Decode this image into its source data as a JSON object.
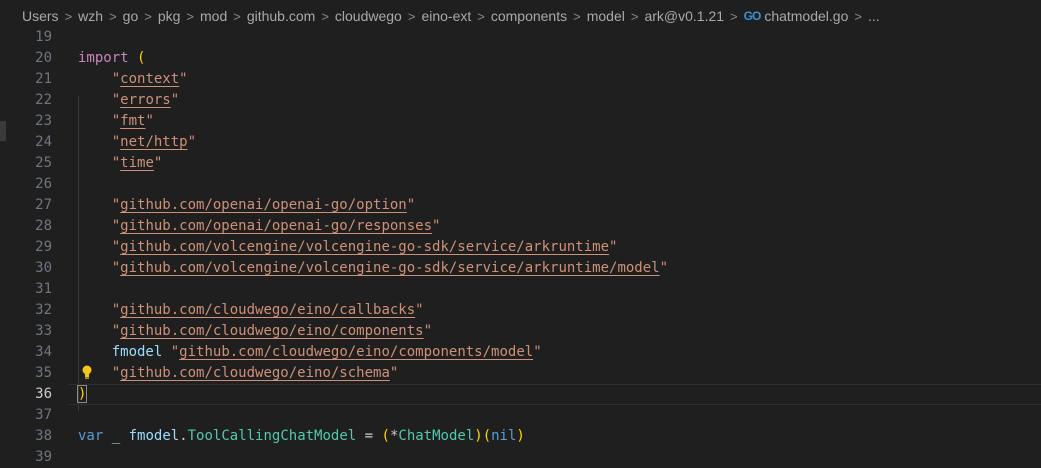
{
  "breadcrumb": {
    "items": [
      "Users",
      "wzh",
      "go",
      "pkg",
      "mod",
      "github.com",
      "cloudwego",
      "eino-ext",
      "components",
      "model",
      "ark@v0.1.21"
    ],
    "file_icon": "GO",
    "file": "chatmodel.go",
    "more": "..."
  },
  "lines": {
    "l19": "19",
    "l20": "20",
    "l21": "21",
    "l22": "22",
    "l23": "23",
    "l24": "24",
    "l25": "25",
    "l26": "26",
    "l27": "27",
    "l28": "28",
    "l29": "29",
    "l30": "30",
    "l31": "31",
    "l32": "32",
    "l33": "33",
    "l34": "34",
    "l35": "35",
    "l36": "36",
    "l37": "37",
    "l38": "38",
    "l39": "39"
  },
  "code": {
    "import_kw": "import",
    "open_paren": "(",
    "close_paren": ")",
    "imp_context": "context",
    "imp_errors": "errors",
    "imp_fmt": "fmt",
    "imp_nethttp": "net/http",
    "imp_time": "time",
    "imp_option": "github.com/openai/openai-go/option",
    "imp_responses": "github.com/openai/openai-go/responses",
    "imp_arkruntime": "github.com/volcengine/volcengine-go-sdk/service/arkruntime",
    "imp_arkmodel": "github.com/volcengine/volcengine-go-sdk/service/arkruntime/model",
    "imp_callbacks": "github.com/cloudwego/eino/callbacks",
    "imp_components": "github.com/cloudwego/eino/components",
    "alias_fmodel": "fmodel",
    "imp_compmodel": "github.com/cloudwego/eino/components/model",
    "imp_schema": "github.com/cloudwego/eino/schema",
    "var_kw": "var",
    "underscore": "_",
    "pkg_fmodel": "fmodel",
    "dot": ".",
    "iface": "ToolCallingChatModel",
    "eq": "=",
    "lparen": "(",
    "star": "*",
    "chatmodel_type": "ChatModel",
    "rparen": ")",
    "nil_kw": "nil"
  },
  "colors": {
    "background": "#1f1f1f",
    "keyword": "#c586c0",
    "string": "#ce9178",
    "identifier": "#9cdcfe",
    "type": "#4ec9b0",
    "bracket": "#ffd700",
    "lightbulb": "#f5c518"
  },
  "icons": {
    "lightbulb": "lightbulb-icon",
    "go_file": "go-file-icon"
  }
}
